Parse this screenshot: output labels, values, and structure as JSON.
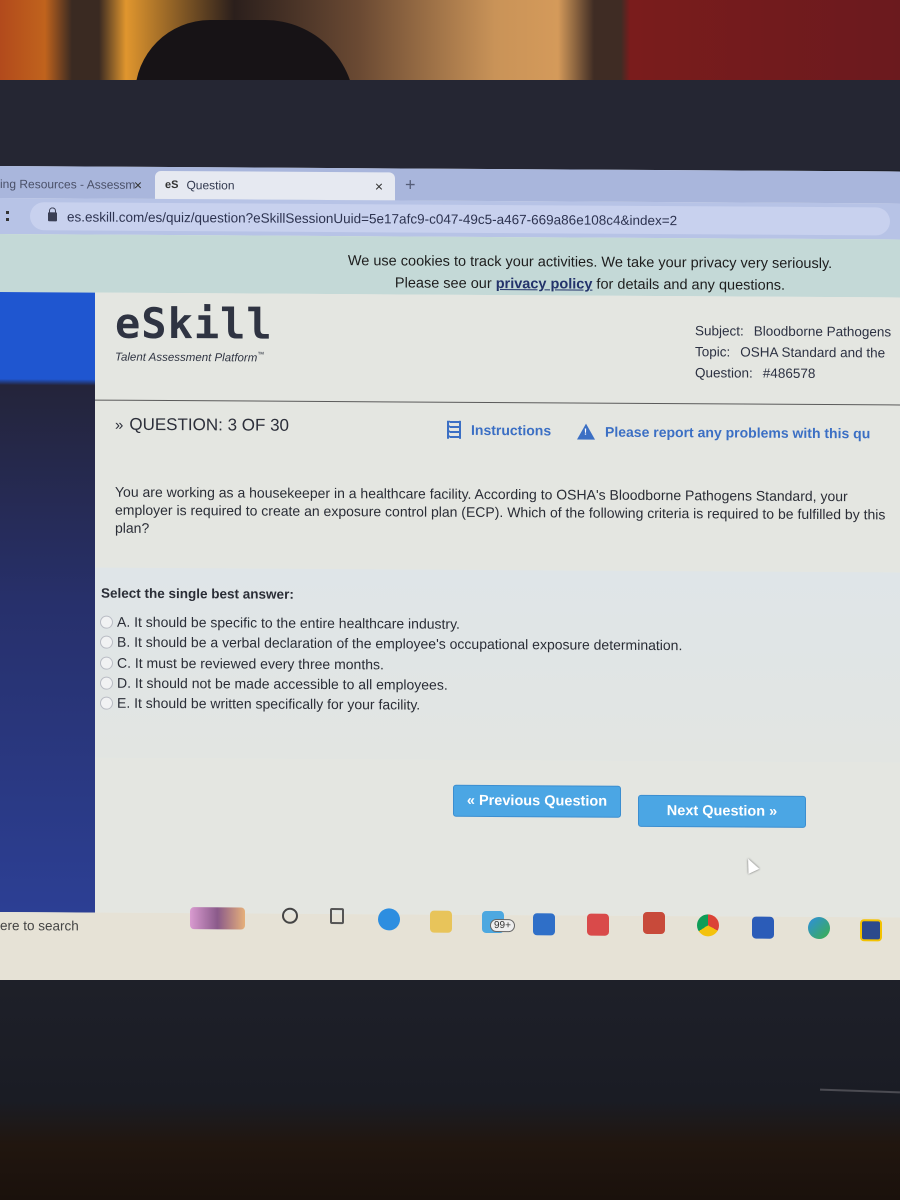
{
  "browser": {
    "tabs": [
      {
        "label": "ing Resources - Assessm",
        "active": false,
        "close": "×"
      },
      {
        "label": "Question",
        "favicon": "eS",
        "active": true,
        "close": "×"
      }
    ],
    "new_tab": "+",
    "url": "es.eskill.com/es/quiz/question?eSkillSessionUuid=5e17afc9-c047-49c5-a467-669a86e108c4&index=2"
  },
  "cookie_banner": {
    "line1": "We use cookies to track your activities. We take your privacy very seriously.",
    "line2_pre": "Please see our ",
    "link": "privacy policy",
    "line2_post": " for details and any questions."
  },
  "header": {
    "logo": "eSkill",
    "tagline": "Talent Assessment Platform",
    "tm": "™",
    "meta": [
      {
        "key": "Subject:",
        "value": "Bloodborne Pathogens"
      },
      {
        "key": "Topic:",
        "value": "OSHA Standard and the"
      },
      {
        "key": "Question:",
        "value": "#486578"
      }
    ]
  },
  "question_bar": {
    "chevron": "»",
    "progress": "QUESTION: 3 OF 30",
    "current": 3,
    "total": 30,
    "instructions": "Instructions",
    "report": "Please report any problems with this qu"
  },
  "question": {
    "text": "You are working as a housekeeper in a healthcare facility. According to OSHA's Bloodborne Pathogens Standard, your employer is required to create an exposure control plan (ECP). Which of the following criteria is required to be fulfilled by this plan?"
  },
  "answers": {
    "prompt": "Select the single best answer:",
    "options": [
      {
        "label": "A. It should be specific to the entire healthcare industry.",
        "selected": false
      },
      {
        "label": "B. It should be a verbal declaration of the employee's occupational exposure determination.",
        "selected": false
      },
      {
        "label": "C. It must be reviewed every three months.",
        "selected": false
      },
      {
        "label": "D. It should not be made accessible to all employees.",
        "selected": false
      },
      {
        "label": "E. It should be written specifically for your facility.",
        "selected": false
      }
    ]
  },
  "nav": {
    "prev": "« Previous Question",
    "next": "Next Question »"
  },
  "taskbar": {
    "search_placeholder": "ere to search",
    "mail_badge": "99+",
    "icons": [
      "weather-widget-icon",
      "cortana-icon",
      "task-view-icon",
      "edge-icon",
      "file-explorer-icon",
      "mail-icon",
      "store-icon",
      "reader-icon",
      "app-icon",
      "chrome-icon",
      "word-icon",
      "edge-dev-icon",
      "norton-icon"
    ]
  },
  "colors": {
    "accent_button": "#4ba6e4",
    "link_blue": "#3b6fc4",
    "sidebar_blue": "#1f56d0"
  }
}
